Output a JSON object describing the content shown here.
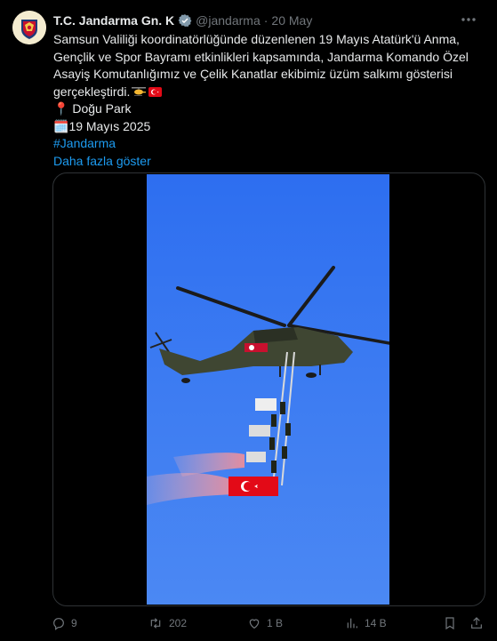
{
  "author": {
    "display_name": "T.C. Jandarma Gn. K",
    "handle": "@jandarma",
    "separator": "·",
    "date": "20 May"
  },
  "post": {
    "lines": [
      "Samsun Valiliği koordinatörlüğünde düzenlenen 19 Mayıs Atatürk'ü Anma,",
      "Gençlik ve Spor Bayramı etkinlikleri kapsamında, Jandarma Komando Özel",
      "Asayiş Komutanlığımız ve Çelik Kanatlar ekibimiz üzüm salkımı gösterisi",
      "gerçekleştirdi."
    ],
    "location_icon": "📍",
    "location": "Doğu Park",
    "calendar_icon": "🗓️",
    "date_line": "19 Mayıs 2025",
    "hashtag": "#Jandarma",
    "show_more": "Daha fazla göster"
  },
  "actions": {
    "replies": "9",
    "reposts": "202",
    "likes": "1 B",
    "views": "14 B"
  },
  "colors": {
    "background": "#000000",
    "text": "#e7e9ea",
    "muted": "#71767b",
    "link": "#1d9bf0",
    "sky": "#3d7cf2"
  }
}
